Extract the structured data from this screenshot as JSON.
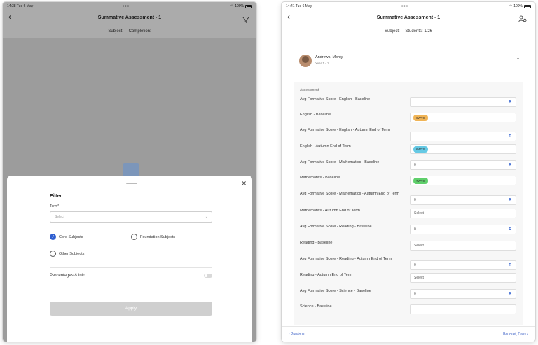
{
  "left": {
    "status": {
      "time": "14:38  Tue 6 May",
      "dots": "•••",
      "battery": "100%"
    },
    "title": "Summative Assessment  - 1",
    "subject_label": "Subject:",
    "completion_label": "Completion:",
    "filter_sheet": {
      "title": "Filter",
      "term_label": "Term*",
      "term_placeholder": "Select",
      "options": {
        "core": "Core Subjects",
        "foundation": "Foundation Subjects",
        "other": "Other Subjects"
      },
      "percent_label": "Percentages & info",
      "apply": "Apply"
    }
  },
  "right": {
    "status": {
      "time": "14:41  Tue 6 May",
      "dots": "•••",
      "battery": "100%"
    },
    "title": "Summative Assessment  - 1",
    "subject_label": "Subject:",
    "students_label": "Students: 1/26",
    "student": {
      "name": "Andrews, Monty",
      "year": "Year 1 - 1"
    },
    "assessment_heading": "Assessment",
    "rows": [
      {
        "label": "Avg Formative Score - English - Baseline",
        "value": "",
        "r": "R"
      },
      {
        "label": "English - Baseline",
        "pill": "6WTS",
        "pill_color": "#f0b456"
      },
      {
        "label": "Avg Formative Score - English - Autumn End of Term",
        "value": "",
        "r": "R"
      },
      {
        "label": "English - Autumn End of Term",
        "pill": "6WTS",
        "pill_color": "#65c9e4"
      },
      {
        "label": "Avg Formative Score - Mathematics - Baseline",
        "value": "0",
        "r": "R"
      },
      {
        "label": "Mathematics - Baseline",
        "pill": "7WTS",
        "pill_color": "#5fcf6b"
      },
      {
        "label": "Avg Formative Score - Mathematics - Autumn End of Term",
        "value": "0",
        "r": "R"
      },
      {
        "label": "Mathematics - Autumn End of Term",
        "value": "Select"
      },
      {
        "label": "Avg Formative Score - Reading - Baseline",
        "value": "0",
        "r": "R"
      },
      {
        "label": "Reading - Baseline",
        "value": "Select"
      },
      {
        "label": "Avg Formative Score - Reading - Autumn End of Term",
        "value": "0",
        "r": "R"
      },
      {
        "label": "Reading - Autumn End of Term",
        "value": "Select"
      },
      {
        "label": "Avg Formative Score - Science - Baseline",
        "value": "0",
        "r": "R"
      },
      {
        "label": "Science - Baseline",
        "value": ""
      }
    ],
    "prev": "‹ Previous",
    "next": "Bouquet, Cass ›"
  }
}
